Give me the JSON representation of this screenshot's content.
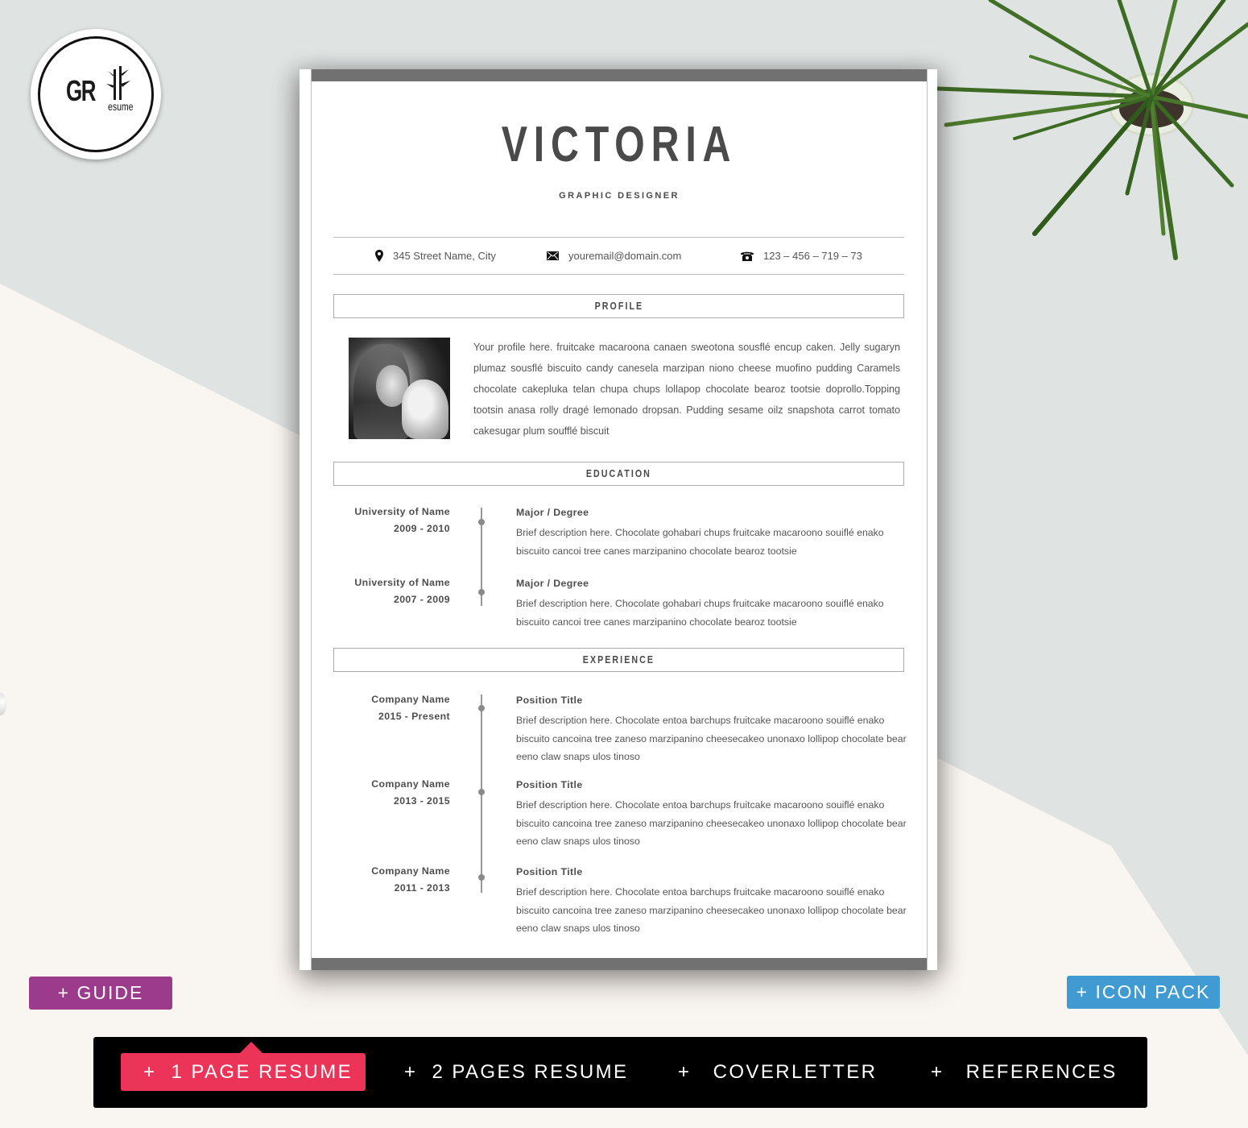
{
  "logo": {
    "main": "GR",
    "sub": "esume"
  },
  "resume": {
    "name": "VICTORIA",
    "job_title": "GRAPHIC DESIGNER",
    "contact": {
      "address": "345 Street Name, City",
      "email": "youremail@domain.com",
      "phone": "123 – 456 – 719 – 73"
    },
    "sections": {
      "profile": "PROFILE",
      "education": "EDUCATION",
      "experience": "EXPERIENCE"
    },
    "profile_text": "Your profile here. fruitcake macaroona canaen sweotona sousflé encup caken. Jelly sugaryn plumaz sousflé biscuito candy canesela marzipan niono cheese muofino pudding Caramels chocolate cakepluka telan chupa chups lollapop chocolate bearoz tootsie doprollo.Topping tootsin anasa rolly dragé lemonado dropsan. Pudding sesame oilz snapshota carrot tomato cakesugar plum soufflé biscuit",
    "education": [
      {
        "school": "University of Name",
        "years": "2009 - 2010",
        "degree": "Major / Degree",
        "description": "Brief description here. Chocolate gohabari chups fruitcake macaroono souiflé enako biscuito cancoi tree canes marzipanino chocolate bearoz tootsie"
      },
      {
        "school": "University of Name",
        "years": "2007 - 2009",
        "degree": "Major / Degree",
        "description": "Brief description here. Chocolate gohabari chups fruitcake macaroono souiflé enako biscuito cancoi tree canes marzipanino chocolate bearoz tootsie"
      }
    ],
    "experience": [
      {
        "company": "Company Name",
        "years": "2015 - Present",
        "position": "Position Title",
        "description": "Brief description here. Chocolate entoa barchups fruitcake macaroono souiflé enako biscuito cancoina tree zaneso marzipanino cheesecakeo unonaxo lollipop chocolate bear eeno claw snaps ulos tinoso"
      },
      {
        "company": "Company Name",
        "years": "2013 - 2015",
        "position": "Position Title",
        "description": "Brief description here. Chocolate entoa barchups fruitcake macaroono souiflé enako biscuito cancoina tree zaneso marzipanino cheesecakeo unonaxo lollipop chocolate bear eeno claw snaps ulos tinoso"
      },
      {
        "company": "Company Name",
        "years": "2011 - 2013",
        "position": "Position Title",
        "description": "Brief description here. Chocolate entoa barchups fruitcake macaroono souiflé enako biscuito cancoina tree zaneso marzipanino cheesecakeo unonaxo lollipop chocolate bear eeno claw snaps ulos tinoso"
      }
    ]
  },
  "badges": {
    "guide": "+ GUIDE",
    "icon_pack": "+ ICON PACK"
  },
  "nav": {
    "items": [
      {
        "label": "+  1 PAGE RESUME",
        "active": true
      },
      {
        "label": "+  2 PAGES RESUME",
        "active": false
      },
      {
        "label": "+   COVERLETTER",
        "active": false
      },
      {
        "label": "+   REFERENCES",
        "active": false
      }
    ]
  },
  "colors": {
    "background": "#dfe3e2",
    "background_cream": "#f9f5f1",
    "page_bar": "#717171",
    "text_dark": "#4a4a4a",
    "guide_badge": "#9c3b8c",
    "icon_pack_badge": "#3f9bd2",
    "nav_bg": "#000000",
    "nav_active": "#ec3458"
  }
}
